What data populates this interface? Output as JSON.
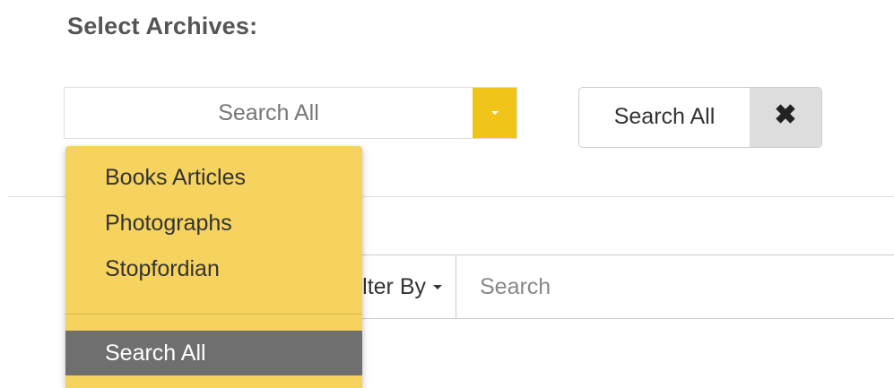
{
  "heading": "Select Archives:",
  "archive_select": {
    "selected_label": "Search All"
  },
  "dropdown": {
    "items": [
      {
        "label": "Books Articles"
      },
      {
        "label": "Photographs"
      },
      {
        "label": "Stopfordian"
      }
    ],
    "active_item": {
      "label": "Search All"
    }
  },
  "selected_tag": {
    "label": "Search All",
    "remove_symbol": "✖"
  },
  "filter": {
    "label": "Filter By"
  },
  "search": {
    "placeholder": "Search"
  },
  "colors": {
    "accent": "#f0c419",
    "dropdown_bg": "#f5d35e",
    "active_bg": "#6f6f6f"
  }
}
